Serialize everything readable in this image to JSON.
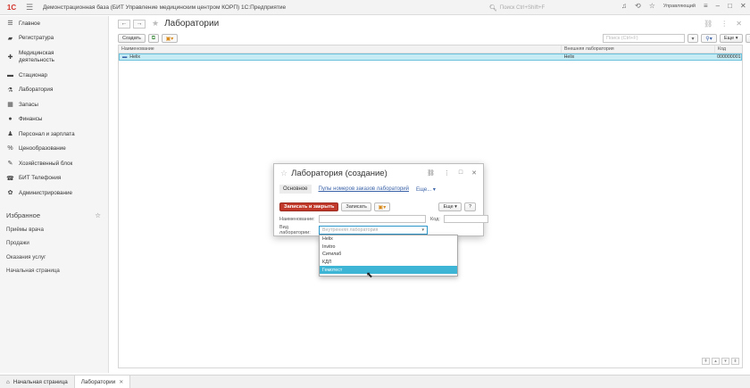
{
  "app": {
    "logo": "1С",
    "title": "Демонстрационная база (БИТ Управление медицинским центром КОРП) 1С:Предприятие",
    "search_placeholder": "Поиск Ctrl+Shift+F",
    "user": "Управляющий"
  },
  "sidebar": {
    "items": [
      {
        "label": "Главное",
        "icon": "list-icon"
      },
      {
        "label": "Регистратура",
        "icon": "folder-icon"
      },
      {
        "label": "Медицинская деятельность",
        "icon": "medical-icon"
      },
      {
        "label": "Стационар",
        "icon": "bed-icon"
      },
      {
        "label": "Лаборатория",
        "icon": "microscope-icon"
      },
      {
        "label": "Запасы",
        "icon": "box-icon"
      },
      {
        "label": "Финансы",
        "icon": "coin-icon"
      },
      {
        "label": "Персонал и зарплата",
        "icon": "people-icon"
      },
      {
        "label": "Ценообразование",
        "icon": "percent-icon"
      },
      {
        "label": "Хозяйственный блок",
        "icon": "wrench-icon"
      },
      {
        "label": "БИТ Телефония",
        "icon": "phone-icon"
      },
      {
        "label": "Администрирование",
        "icon": "gear-icon"
      }
    ],
    "favorites_title": "Избранное",
    "favorites": [
      "Приёмы врача",
      "Продажи",
      "Оказания услуг",
      "Начальная страница"
    ]
  },
  "main": {
    "title": "Лаборатории",
    "create_label": "Создать",
    "search_placeholder": "Поиск (Ctrl+F)",
    "more_label": "Еще",
    "help_label": "?",
    "columns": [
      "Наименование",
      "Внешняя лаборатория",
      "Код"
    ],
    "rows": [
      {
        "name": "Helix",
        "external": "Helix",
        "code": "000000001"
      }
    ]
  },
  "dialog": {
    "title": "Лаборатория (создание)",
    "tab_main": "Основное",
    "tab_link": "Пулы номеров заказов лабораторий",
    "tab_more": "Еще...",
    "save_close_label": "Записать и закрыть",
    "save_label": "Записать",
    "more_label": "Еще",
    "help_label": "?",
    "name_label": "Наименование:",
    "code_label": "Код:",
    "type_label": "Вид лаборатории:",
    "type_placeholder": "Внутренняя лаборатория"
  },
  "dropdown": {
    "options": [
      "Helix",
      "Invitro",
      "Ситилаб",
      "КДЛ",
      "Гемотест"
    ],
    "selected_index": 4
  },
  "bottom_tabs": [
    "Начальная страница",
    "Лаборатории"
  ],
  "colors": {
    "accent_red": "#c0392b",
    "selection_blue": "#3eb5d4",
    "row_highlight": "#c5ecf5"
  }
}
